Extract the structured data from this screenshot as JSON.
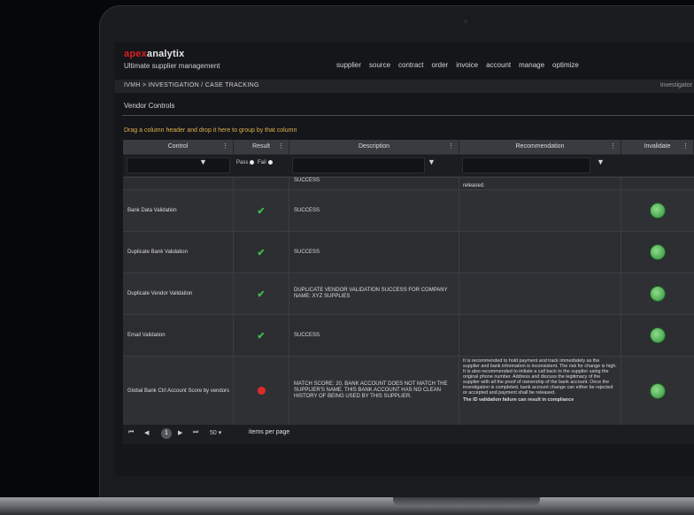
{
  "app": {
    "logo_part1": "apex",
    "logo_part2": "analytix",
    "tagline": "Ultimate supplier management",
    "nav": [
      "supplier",
      "source",
      "contract",
      "order",
      "invoice",
      "account",
      "manage",
      "optimize"
    ]
  },
  "breadcrumb": "IVMH > INVESTIGATION / CASE TRACKING",
  "user": "Investigator",
  "section_title": "Vendor Controls",
  "group_hint": "Drag a column header and drop it here to group by that column",
  "columns": [
    {
      "label": "Control"
    },
    {
      "label": "Result"
    },
    {
      "label": "Description"
    },
    {
      "label": "Recommendation"
    },
    {
      "label": "Invalidate"
    }
  ],
  "filter": {
    "pass_label": "Pass",
    "fail_label": "Fail"
  },
  "partial_row": {
    "description": "SUCCESS",
    "recommendation": "released."
  },
  "rows": [
    {
      "control": "Bank Data Validation",
      "result": "pass",
      "description": "SUCCESS",
      "recommendation": ""
    },
    {
      "control": "Duplicate Bank Validation",
      "result": "pass",
      "description": "SUCCESS",
      "recommendation": ""
    },
    {
      "control": "Duplicate Vendor Validation",
      "result": "pass",
      "description": "DUPLICATE VENDOR VALIDATION SUCCESS FOR COMPANY NAME: XYZ SUPPLIES",
      "recommendation": ""
    },
    {
      "control": "Email Validation",
      "result": "pass",
      "description": "SUCCESS",
      "recommendation": ""
    },
    {
      "control": "Global Bank Ctrl Account Score by vendors",
      "result": "fail",
      "description": "MATCH SCORE: 20, BANK ACCOUNT DOES NOT MATCH THE SUPPLIER'S NAME. THIS BANK ACCOUNT HAS NO CLEAN HISTORY OF BEING USED BY THIS SUPPLIER.",
      "recommendation": "It is recommended to hold payment and track immediately as the supplier and bank information is inconsistent. The risk for change is high. It is also recommended to initiate a call back to the supplier using the original phone number. Address and discuss the legitimacy of the supplier with all the proof of ownership of the bank account. Once the investigation is completed, bank account change can either be rejected or accepted and payment shall be released."
    }
  ],
  "trailing_text": "The ID validation failure can result in compliance",
  "pager": {
    "first": "⏮",
    "prev": "◀",
    "current_page": "1",
    "next": "▶",
    "last": "⏭",
    "page_size": "50",
    "items_label": "items per page"
  }
}
